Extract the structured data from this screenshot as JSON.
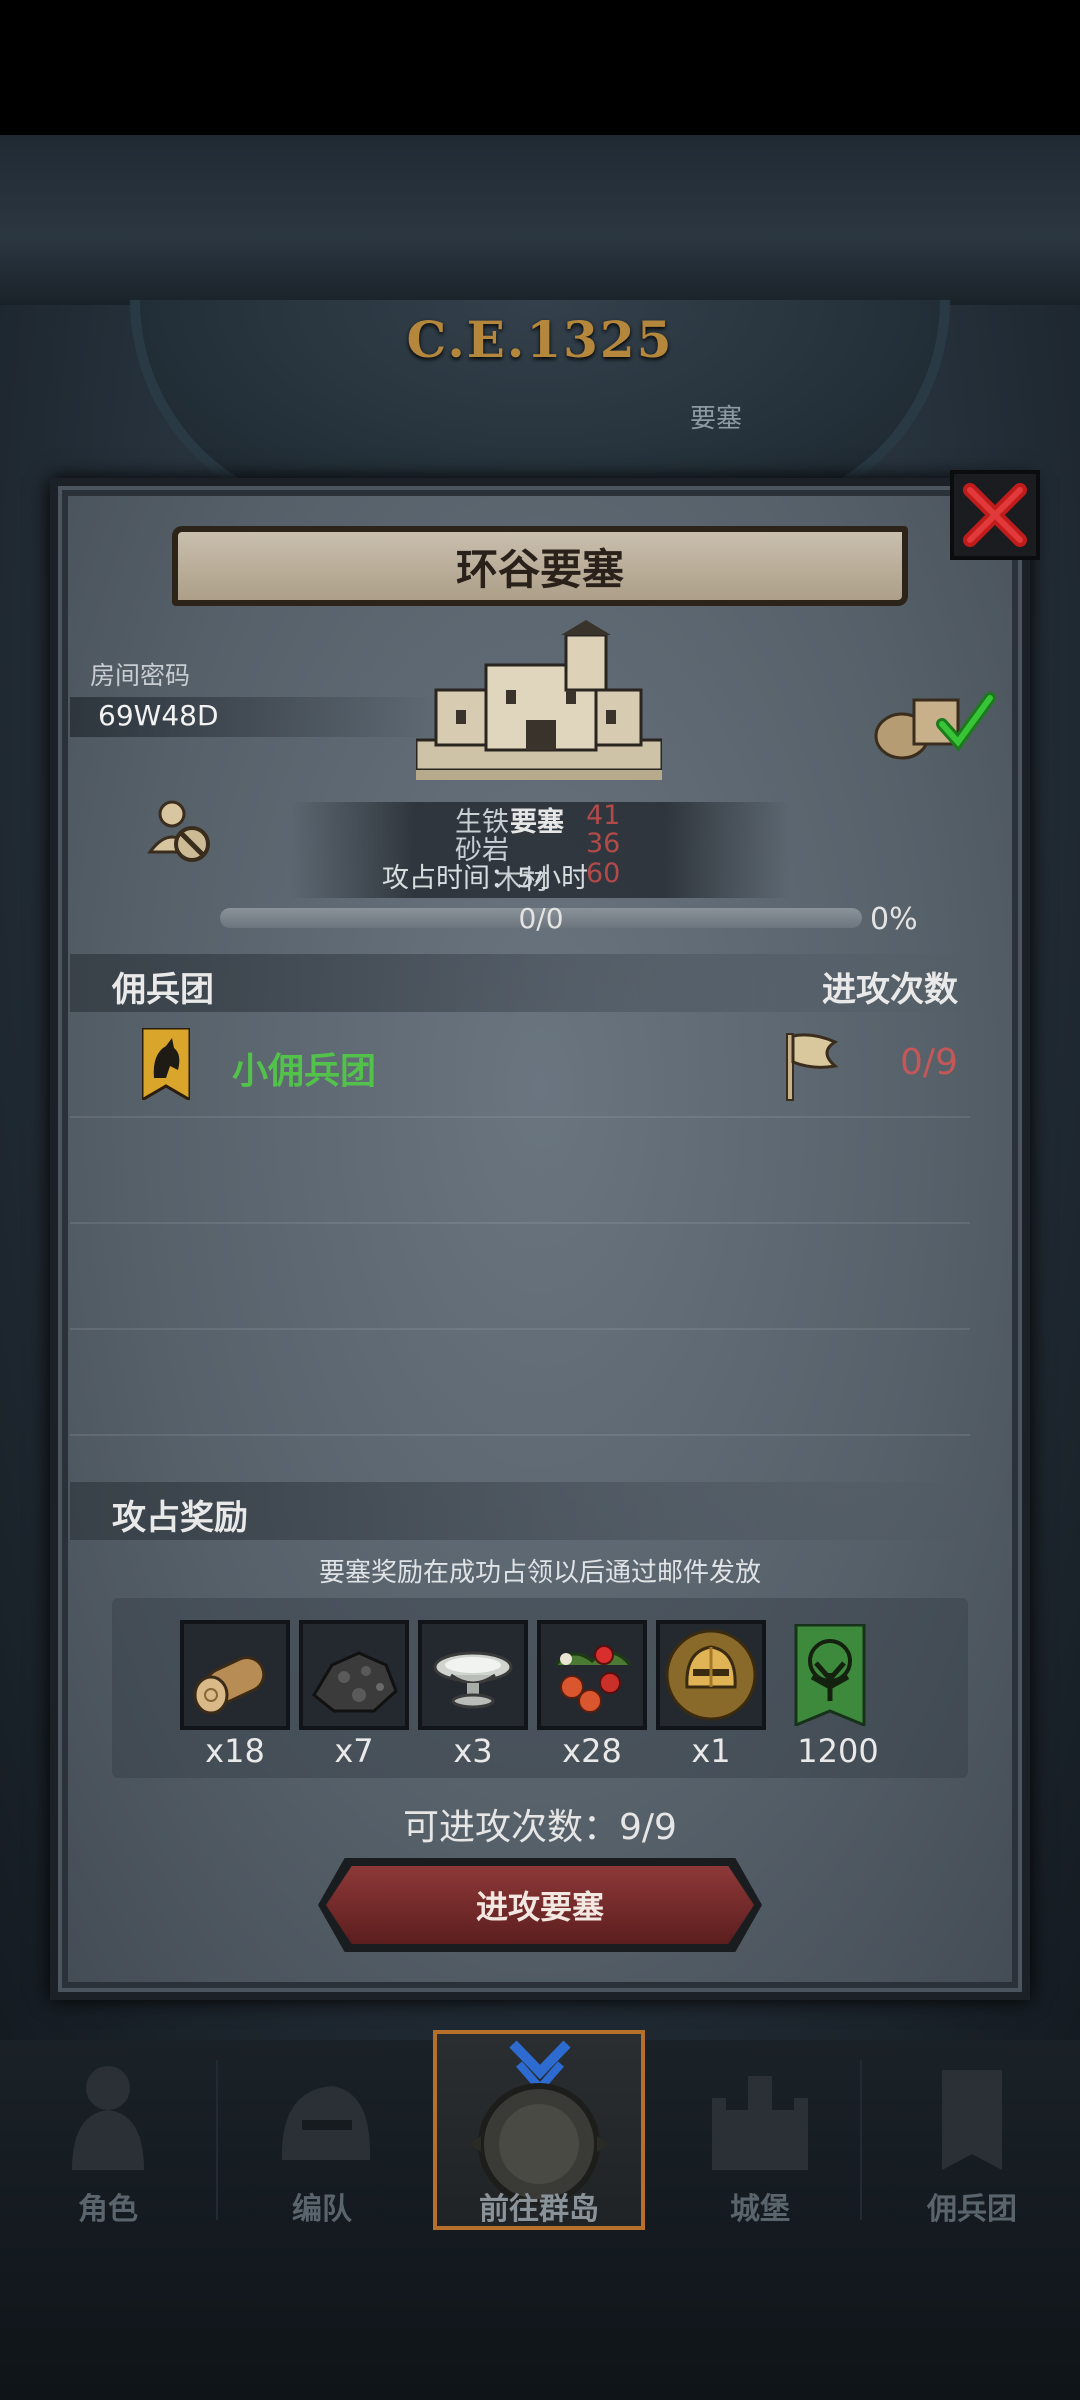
{
  "era": "C.E.1325",
  "background_labels": {
    "fort_tag": "要塞"
  },
  "modal": {
    "title": "环谷要塞",
    "room_code_label": "房间密码",
    "room_code": "69W48D",
    "fort_info": {
      "line1": "生铁",
      "line1_val": "41",
      "line2": "砂岩",
      "line2_val": "36",
      "line3": "木材",
      "line3_val": "60",
      "overlay_label": "要塞",
      "capture_time": "攻占时间：5小时"
    },
    "progress": {
      "text": "0/0",
      "percent_label": "0%",
      "value": 0
    },
    "mercenary_section": {
      "title": "佣兵团",
      "count_header": "进攻次数",
      "rows": [
        {
          "name": "小佣兵团",
          "attacks": "0/9"
        }
      ]
    },
    "reward_section": {
      "title": "攻占奖励",
      "note": "要塞奖励在成功占领以后通过邮件发放",
      "items": [
        {
          "icon": "wood-log-icon",
          "qty": "x18"
        },
        {
          "icon": "ore-rock-icon",
          "qty": "x7"
        },
        {
          "icon": "silver-bowl-icon",
          "qty": "x3"
        },
        {
          "icon": "berries-icon",
          "qty": "x28"
        },
        {
          "icon": "golden-helmet-icon",
          "qty": "x1"
        },
        {
          "icon": "tree-banner-icon",
          "qty": "1200"
        }
      ]
    },
    "attempts_text": "可进攻次数：9/9",
    "attack_button": "进攻要塞"
  },
  "bottom_nav": {
    "items": [
      {
        "label": "角色",
        "icon": "knight-icon",
        "active": false
      },
      {
        "label": "编队",
        "icon": "helmet-formation-icon",
        "active": false
      },
      {
        "label": "前往群岛",
        "icon": "compass-icon",
        "active": true
      },
      {
        "label": "城堡",
        "icon": "castle-icon",
        "active": false
      },
      {
        "label": "佣兵团",
        "icon": "mercenary-icon",
        "active": false
      }
    ]
  },
  "colors": {
    "accent_gold": "#b4873d",
    "mercenary_green": "#52c24a",
    "count_red": "#c45858",
    "button_red": "#8e3838"
  }
}
